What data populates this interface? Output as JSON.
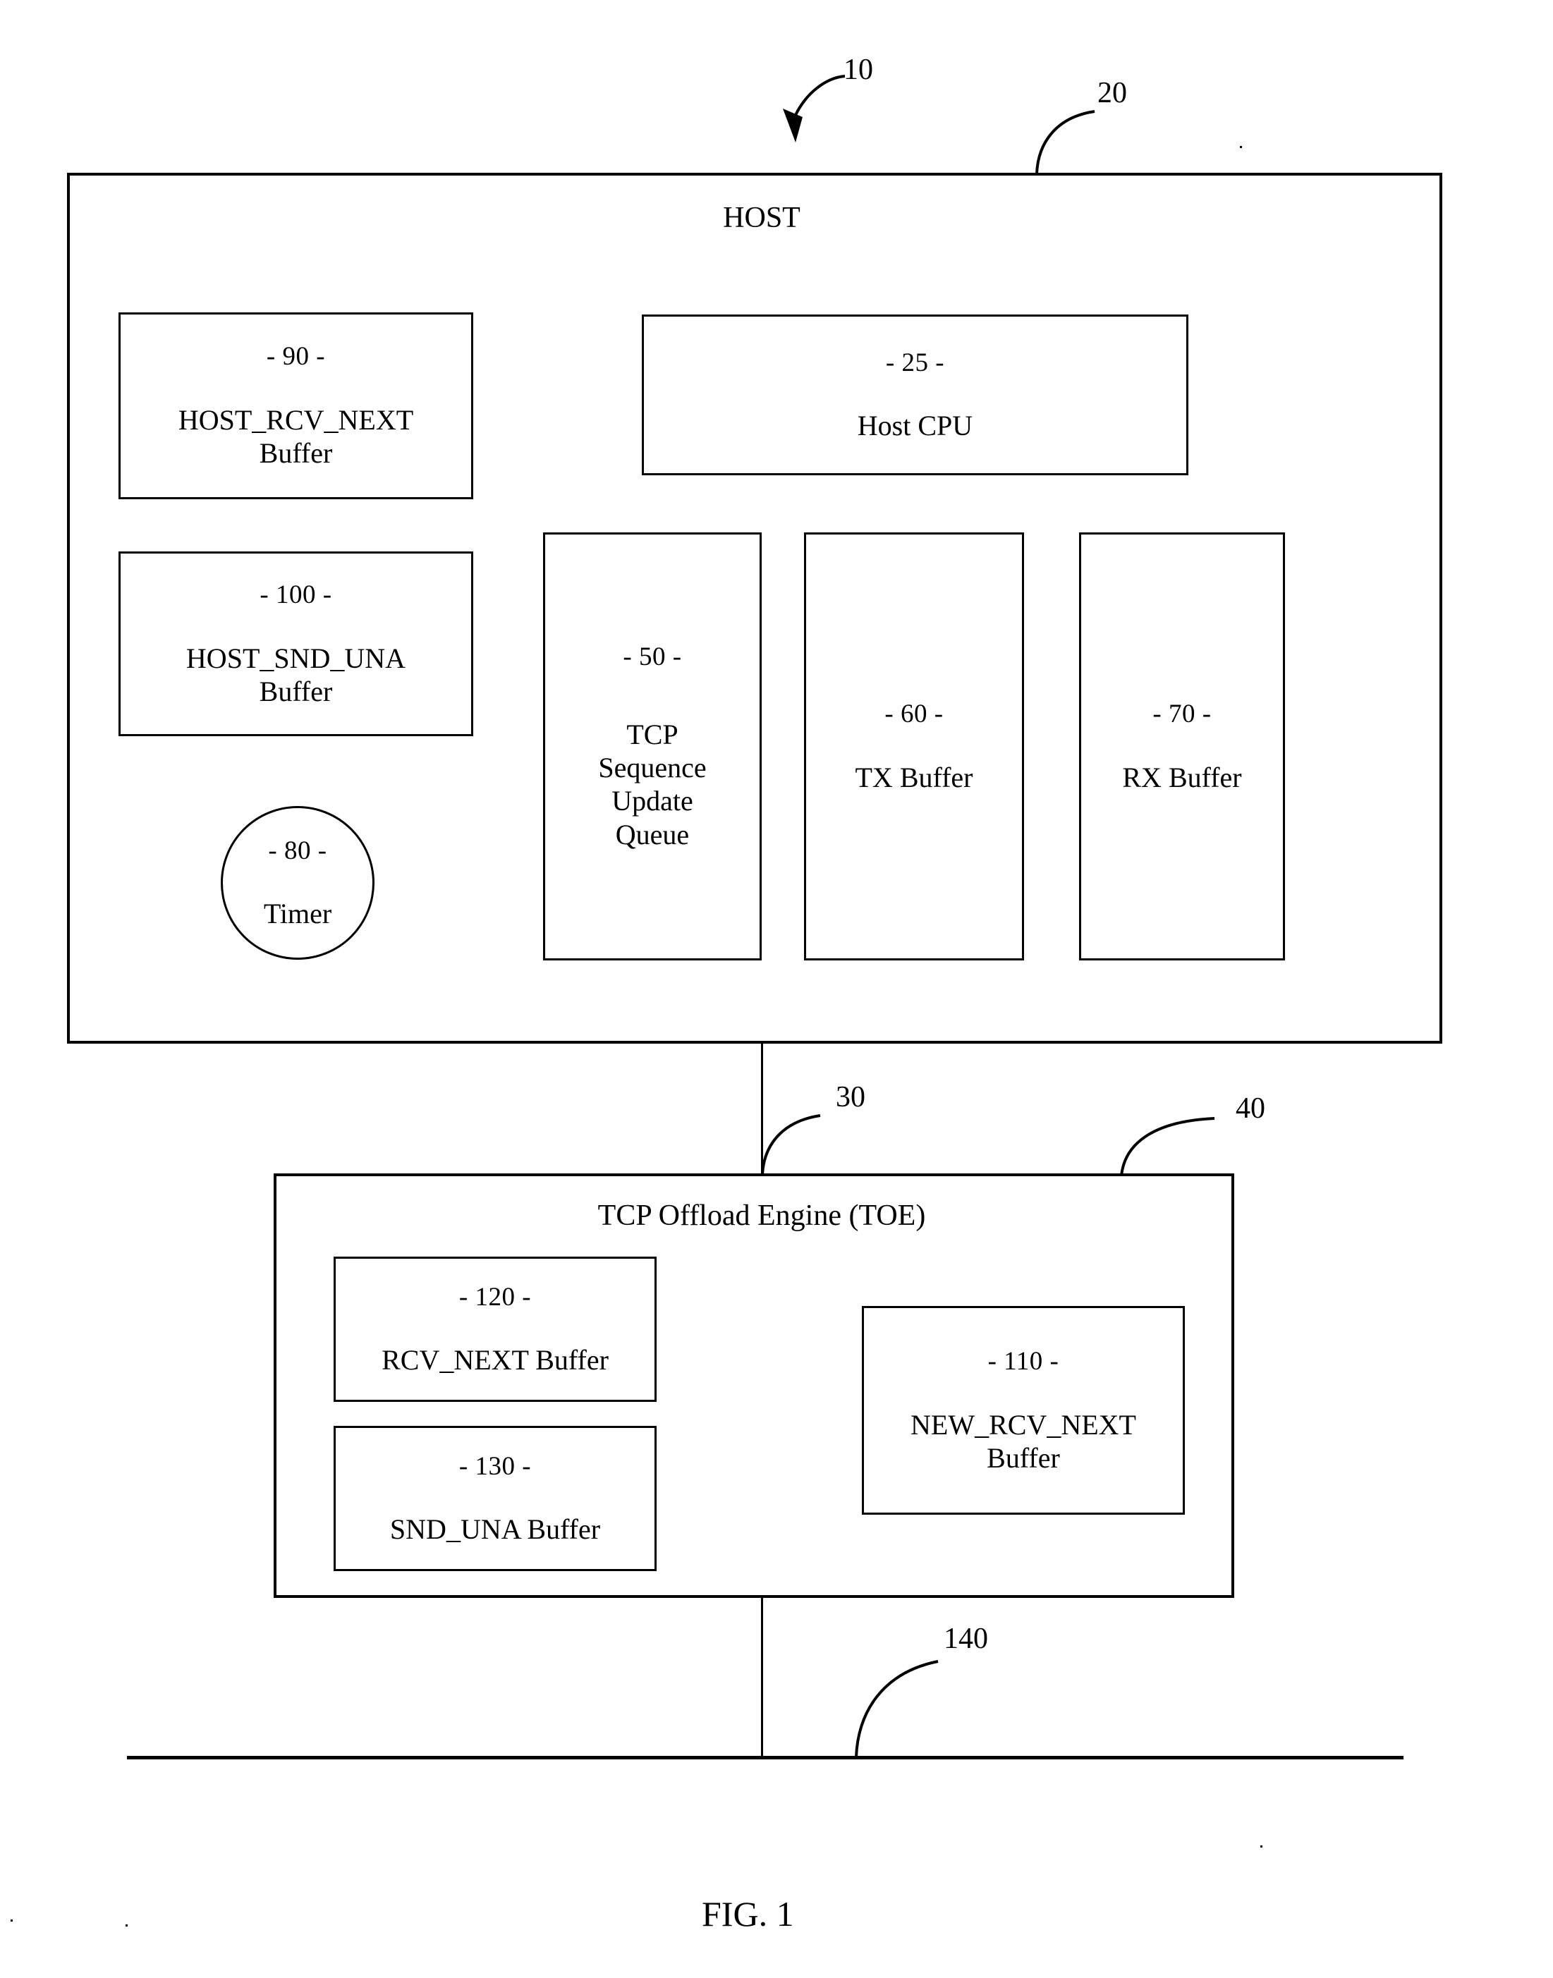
{
  "figure": {
    "caption": "FIG. 1",
    "system_ref": "10"
  },
  "host": {
    "title": "HOST",
    "ref": "20",
    "blocks": [
      {
        "ref": "- 90 -",
        "label": "HOST_RCV_NEXT\nBuffer",
        "name": "host-rcv-next-buffer"
      },
      {
        "ref": "- 100 -",
        "label": "HOST_SND_UNA\nBuffer",
        "name": "host-snd-una-buffer"
      },
      {
        "ref": "- 25 -",
        "label": "Host CPU",
        "name": "host-cpu"
      },
      {
        "ref": "- 50 -",
        "label": "TCP\nSequence\nUpdate\nQueue",
        "name": "tcp-sequence-update-queue"
      },
      {
        "ref": "- 60 -",
        "label": "TX Buffer",
        "name": "tx-buffer"
      },
      {
        "ref": "- 70 -",
        "label": "RX Buffer",
        "name": "rx-buffer"
      }
    ],
    "timer": {
      "ref": "- 80 -",
      "label": "Timer",
      "name": "timer"
    }
  },
  "bus": {
    "host_to_toe_ref": "30",
    "network_ref": "140"
  },
  "toe": {
    "title": "TCP Offload Engine (TOE)",
    "ref": "40",
    "blocks": [
      {
        "ref": "- 120 -",
        "label": "RCV_NEXT Buffer",
        "name": "rcv-next-buffer"
      },
      {
        "ref": "- 130 -",
        "label": "SND_UNA Buffer",
        "name": "snd-una-buffer"
      },
      {
        "ref": "- 110 -",
        "label": "NEW_RCV_NEXT\nBuffer",
        "name": "new-rcv-next-buffer"
      }
    ]
  }
}
